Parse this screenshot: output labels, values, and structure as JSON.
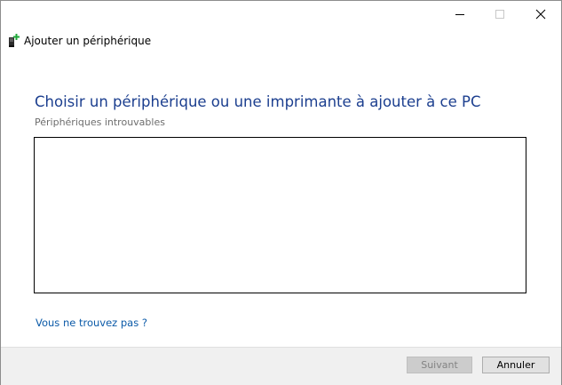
{
  "window": {
    "title": "Ajouter un périphérique",
    "controls": [
      "minimize-icon",
      "maximize-icon",
      "close-icon"
    ]
  },
  "icons": {
    "wizard": "add-device-icon",
    "accent_color": "#1fa83a"
  },
  "main": {
    "heading": "Choisir un périphérique ou une imprimante à ajouter à ce PC",
    "status": "Périphériques introuvables",
    "help_link": "Vous ne trouvez pas ?"
  },
  "footer": {
    "next_label": "Suivant",
    "next_enabled": false,
    "cancel_label": "Annuler"
  },
  "colors": {
    "heading": "#1c3f8f",
    "link": "#0b5aa8",
    "footer_bg": "#f0f0f0"
  }
}
